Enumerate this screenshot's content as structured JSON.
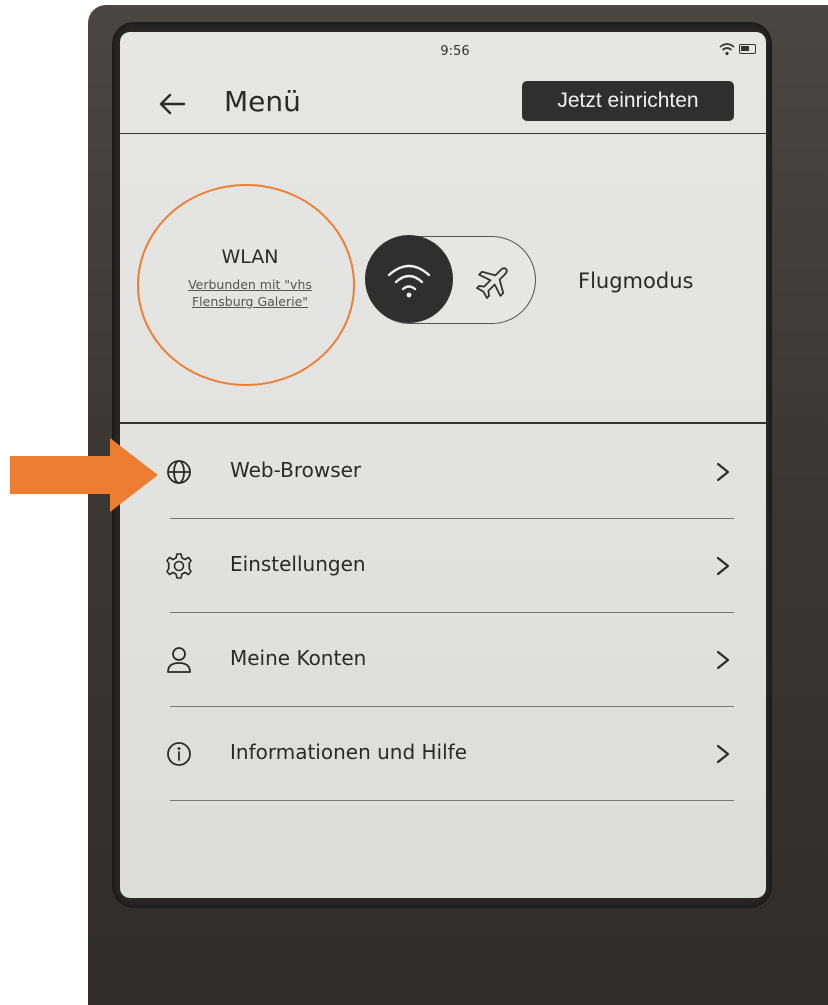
{
  "status": {
    "time": "9:56"
  },
  "header": {
    "title": "Menü",
    "setup_button": "Jetzt einrichten"
  },
  "connectivity": {
    "wlan_label": "WLAN",
    "wlan_status_line1": "Verbunden mit \"vhs",
    "wlan_status_line2": "Flensburg Galerie\"",
    "flight_mode_label": "Flugmodus",
    "active_mode": "wlan"
  },
  "menu": {
    "items": [
      {
        "label": "Web-Browser",
        "icon": "globe-icon"
      },
      {
        "label": "Einstellungen",
        "icon": "gear-icon"
      },
      {
        "label": "Meine Konten",
        "icon": "user-icon"
      },
      {
        "label": "Informationen und Hilfe",
        "icon": "info-icon"
      }
    ]
  },
  "colors": {
    "annotation": "#ed7d31",
    "button_bg": "#2f2f2f",
    "screen_bg": "#e4e4e2"
  }
}
